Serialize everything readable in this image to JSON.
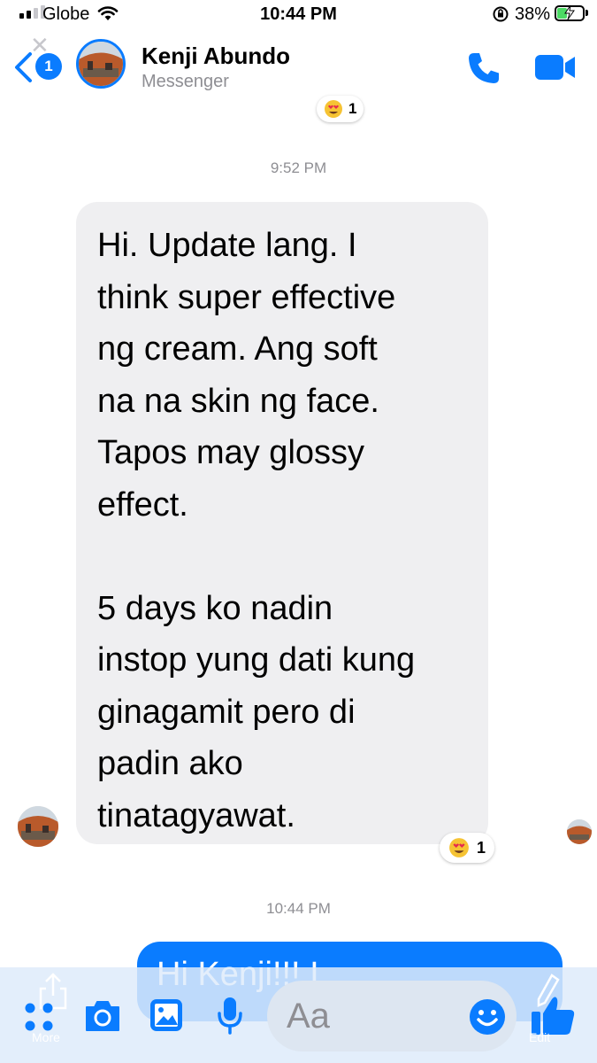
{
  "status_bar": {
    "carrier": "Globe",
    "time": "10:44 PM",
    "battery": "38%",
    "battery_level": 0.38
  },
  "header": {
    "back_badge": "1",
    "contact_name": "Kenji Abundo",
    "subtitle": "Messenger"
  },
  "messages": {
    "top_reaction_count": "1",
    "timestamp_1": "9:52 PM",
    "incoming_text": "Hi. Update lang. I\nthink super effective\nng cream. Ang soft\nna na skin ng face.\nTapos may glossy\neffect.\n\n5 days ko nadin\ninstop yung dati kung\nginagamit pero di\npadin ako\ntinatagyawat.",
    "reaction_count": "1",
    "timestamp_2": "10:44 PM",
    "outgoing_text": "Hi Kenji!!! I"
  },
  "composer": {
    "placeholder": "Aa",
    "more_label": "More",
    "edit_label": "Edit"
  },
  "colors": {
    "accent": "#0a7cff",
    "bubble_gray": "#efeff1",
    "battery_green": "#4cd964"
  },
  "icons": [
    "back-chevron-icon",
    "phone-icon",
    "video-camera-icon",
    "heart-eyes-emoji-icon",
    "more-dots-icon",
    "camera-icon",
    "gallery-icon",
    "microphone-icon",
    "emoji-icon",
    "thumbs-up-icon"
  ]
}
